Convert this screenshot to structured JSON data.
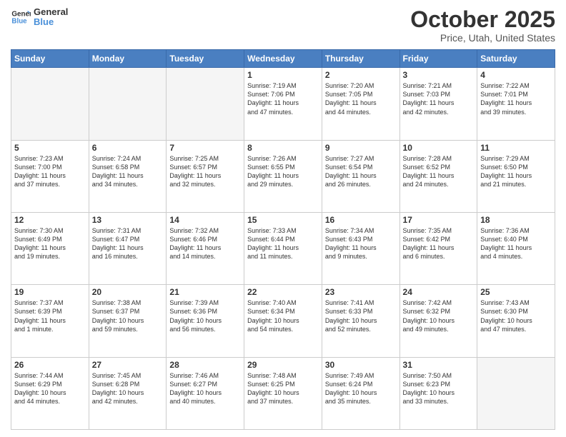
{
  "header": {
    "logo_general": "General",
    "logo_blue": "Blue",
    "month": "October 2025",
    "location": "Price, Utah, United States"
  },
  "weekdays": [
    "Sunday",
    "Monday",
    "Tuesday",
    "Wednesday",
    "Thursday",
    "Friday",
    "Saturday"
  ],
  "weeks": [
    [
      {
        "day": "",
        "info": ""
      },
      {
        "day": "",
        "info": ""
      },
      {
        "day": "",
        "info": ""
      },
      {
        "day": "1",
        "info": "Sunrise: 7:19 AM\nSunset: 7:06 PM\nDaylight: 11 hours\nand 47 minutes."
      },
      {
        "day": "2",
        "info": "Sunrise: 7:20 AM\nSunset: 7:05 PM\nDaylight: 11 hours\nand 44 minutes."
      },
      {
        "day": "3",
        "info": "Sunrise: 7:21 AM\nSunset: 7:03 PM\nDaylight: 11 hours\nand 42 minutes."
      },
      {
        "day": "4",
        "info": "Sunrise: 7:22 AM\nSunset: 7:01 PM\nDaylight: 11 hours\nand 39 minutes."
      }
    ],
    [
      {
        "day": "5",
        "info": "Sunrise: 7:23 AM\nSunset: 7:00 PM\nDaylight: 11 hours\nand 37 minutes."
      },
      {
        "day": "6",
        "info": "Sunrise: 7:24 AM\nSunset: 6:58 PM\nDaylight: 11 hours\nand 34 minutes."
      },
      {
        "day": "7",
        "info": "Sunrise: 7:25 AM\nSunset: 6:57 PM\nDaylight: 11 hours\nand 32 minutes."
      },
      {
        "day": "8",
        "info": "Sunrise: 7:26 AM\nSunset: 6:55 PM\nDaylight: 11 hours\nand 29 minutes."
      },
      {
        "day": "9",
        "info": "Sunrise: 7:27 AM\nSunset: 6:54 PM\nDaylight: 11 hours\nand 26 minutes."
      },
      {
        "day": "10",
        "info": "Sunrise: 7:28 AM\nSunset: 6:52 PM\nDaylight: 11 hours\nand 24 minutes."
      },
      {
        "day": "11",
        "info": "Sunrise: 7:29 AM\nSunset: 6:50 PM\nDaylight: 11 hours\nand 21 minutes."
      }
    ],
    [
      {
        "day": "12",
        "info": "Sunrise: 7:30 AM\nSunset: 6:49 PM\nDaylight: 11 hours\nand 19 minutes."
      },
      {
        "day": "13",
        "info": "Sunrise: 7:31 AM\nSunset: 6:47 PM\nDaylight: 11 hours\nand 16 minutes."
      },
      {
        "day": "14",
        "info": "Sunrise: 7:32 AM\nSunset: 6:46 PM\nDaylight: 11 hours\nand 14 minutes."
      },
      {
        "day": "15",
        "info": "Sunrise: 7:33 AM\nSunset: 6:44 PM\nDaylight: 11 hours\nand 11 minutes."
      },
      {
        "day": "16",
        "info": "Sunrise: 7:34 AM\nSunset: 6:43 PM\nDaylight: 11 hours\nand 9 minutes."
      },
      {
        "day": "17",
        "info": "Sunrise: 7:35 AM\nSunset: 6:42 PM\nDaylight: 11 hours\nand 6 minutes."
      },
      {
        "day": "18",
        "info": "Sunrise: 7:36 AM\nSunset: 6:40 PM\nDaylight: 11 hours\nand 4 minutes."
      }
    ],
    [
      {
        "day": "19",
        "info": "Sunrise: 7:37 AM\nSunset: 6:39 PM\nDaylight: 11 hours\nand 1 minute."
      },
      {
        "day": "20",
        "info": "Sunrise: 7:38 AM\nSunset: 6:37 PM\nDaylight: 10 hours\nand 59 minutes."
      },
      {
        "day": "21",
        "info": "Sunrise: 7:39 AM\nSunset: 6:36 PM\nDaylight: 10 hours\nand 56 minutes."
      },
      {
        "day": "22",
        "info": "Sunrise: 7:40 AM\nSunset: 6:34 PM\nDaylight: 10 hours\nand 54 minutes."
      },
      {
        "day": "23",
        "info": "Sunrise: 7:41 AM\nSunset: 6:33 PM\nDaylight: 10 hours\nand 52 minutes."
      },
      {
        "day": "24",
        "info": "Sunrise: 7:42 AM\nSunset: 6:32 PM\nDaylight: 10 hours\nand 49 minutes."
      },
      {
        "day": "25",
        "info": "Sunrise: 7:43 AM\nSunset: 6:30 PM\nDaylight: 10 hours\nand 47 minutes."
      }
    ],
    [
      {
        "day": "26",
        "info": "Sunrise: 7:44 AM\nSunset: 6:29 PM\nDaylight: 10 hours\nand 44 minutes."
      },
      {
        "day": "27",
        "info": "Sunrise: 7:45 AM\nSunset: 6:28 PM\nDaylight: 10 hours\nand 42 minutes."
      },
      {
        "day": "28",
        "info": "Sunrise: 7:46 AM\nSunset: 6:27 PM\nDaylight: 10 hours\nand 40 minutes."
      },
      {
        "day": "29",
        "info": "Sunrise: 7:48 AM\nSunset: 6:25 PM\nDaylight: 10 hours\nand 37 minutes."
      },
      {
        "day": "30",
        "info": "Sunrise: 7:49 AM\nSunset: 6:24 PM\nDaylight: 10 hours\nand 35 minutes."
      },
      {
        "day": "31",
        "info": "Sunrise: 7:50 AM\nSunset: 6:23 PM\nDaylight: 10 hours\nand 33 minutes."
      },
      {
        "day": "",
        "info": ""
      }
    ]
  ]
}
